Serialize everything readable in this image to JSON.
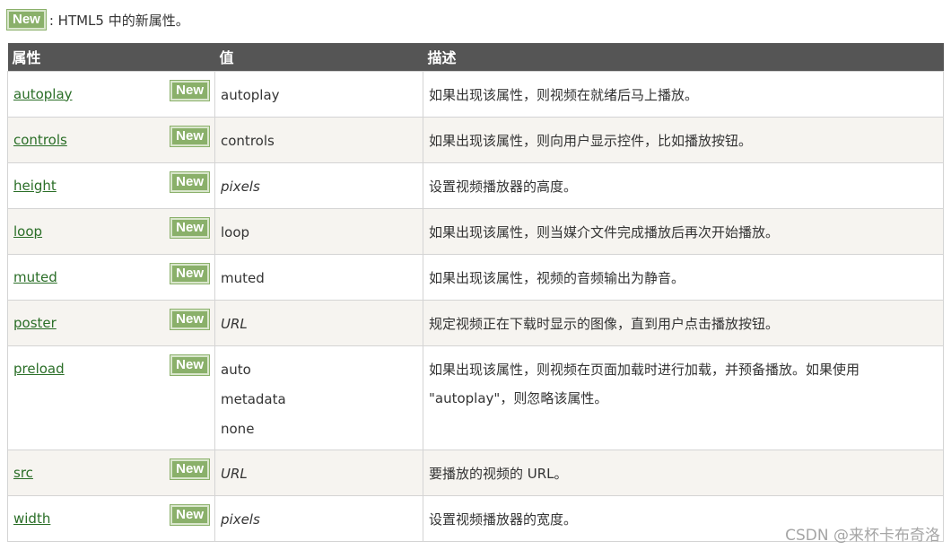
{
  "badge_label": "New",
  "note": {
    "text": ": HTML5 中的新属性。"
  },
  "table": {
    "headers": [
      "属性",
      "值",
      "描述"
    ],
    "rows": [
      {
        "attr": "autoplay",
        "values": [
          "autoplay"
        ],
        "italic": false,
        "desc": [
          "如果出现该属性，则视频在就绪后马上播放。"
        ]
      },
      {
        "attr": "controls",
        "values": [
          "controls"
        ],
        "italic": false,
        "desc": [
          "如果出现该属性，则向用户显示控件，比如播放按钮。"
        ]
      },
      {
        "attr": "height",
        "values": [
          "pixels"
        ],
        "italic": true,
        "desc": [
          "设置视频播放器的高度。"
        ]
      },
      {
        "attr": "loop",
        "values": [
          "loop"
        ],
        "italic": false,
        "desc": [
          "如果出现该属性，则当媒介文件完成播放后再次开始播放。"
        ]
      },
      {
        "attr": "muted",
        "values": [
          "muted"
        ],
        "italic": false,
        "desc": [
          "如果出现该属性，视频的音频输出为静音。"
        ]
      },
      {
        "attr": "poster",
        "values": [
          "URL"
        ],
        "italic": true,
        "desc": [
          "规定视频正在下载时显示的图像，直到用户点击播放按钮。"
        ]
      },
      {
        "attr": "preload",
        "values": [
          "auto",
          "metadata",
          "none"
        ],
        "italic": false,
        "desc": [
          "如果出现该属性，则视频在页面加载时进行加载，并预备播放。如果使用",
          "\"autoplay\"，则忽略该属性。"
        ]
      },
      {
        "attr": "src",
        "values": [
          "URL"
        ],
        "italic": true,
        "desc": [
          "要播放的视频的 URL。"
        ]
      },
      {
        "attr": "width",
        "values": [
          "pixels"
        ],
        "italic": true,
        "desc": [
          "设置视频播放器的宽度。"
        ]
      }
    ]
  },
  "watermark": "CSDN @来杯卡布奇洛",
  "colors": {
    "header_bg": "#555555",
    "badge_bg": "#8ab06a",
    "link": "#2a6e27",
    "alt_row": "#f6f4f0"
  }
}
